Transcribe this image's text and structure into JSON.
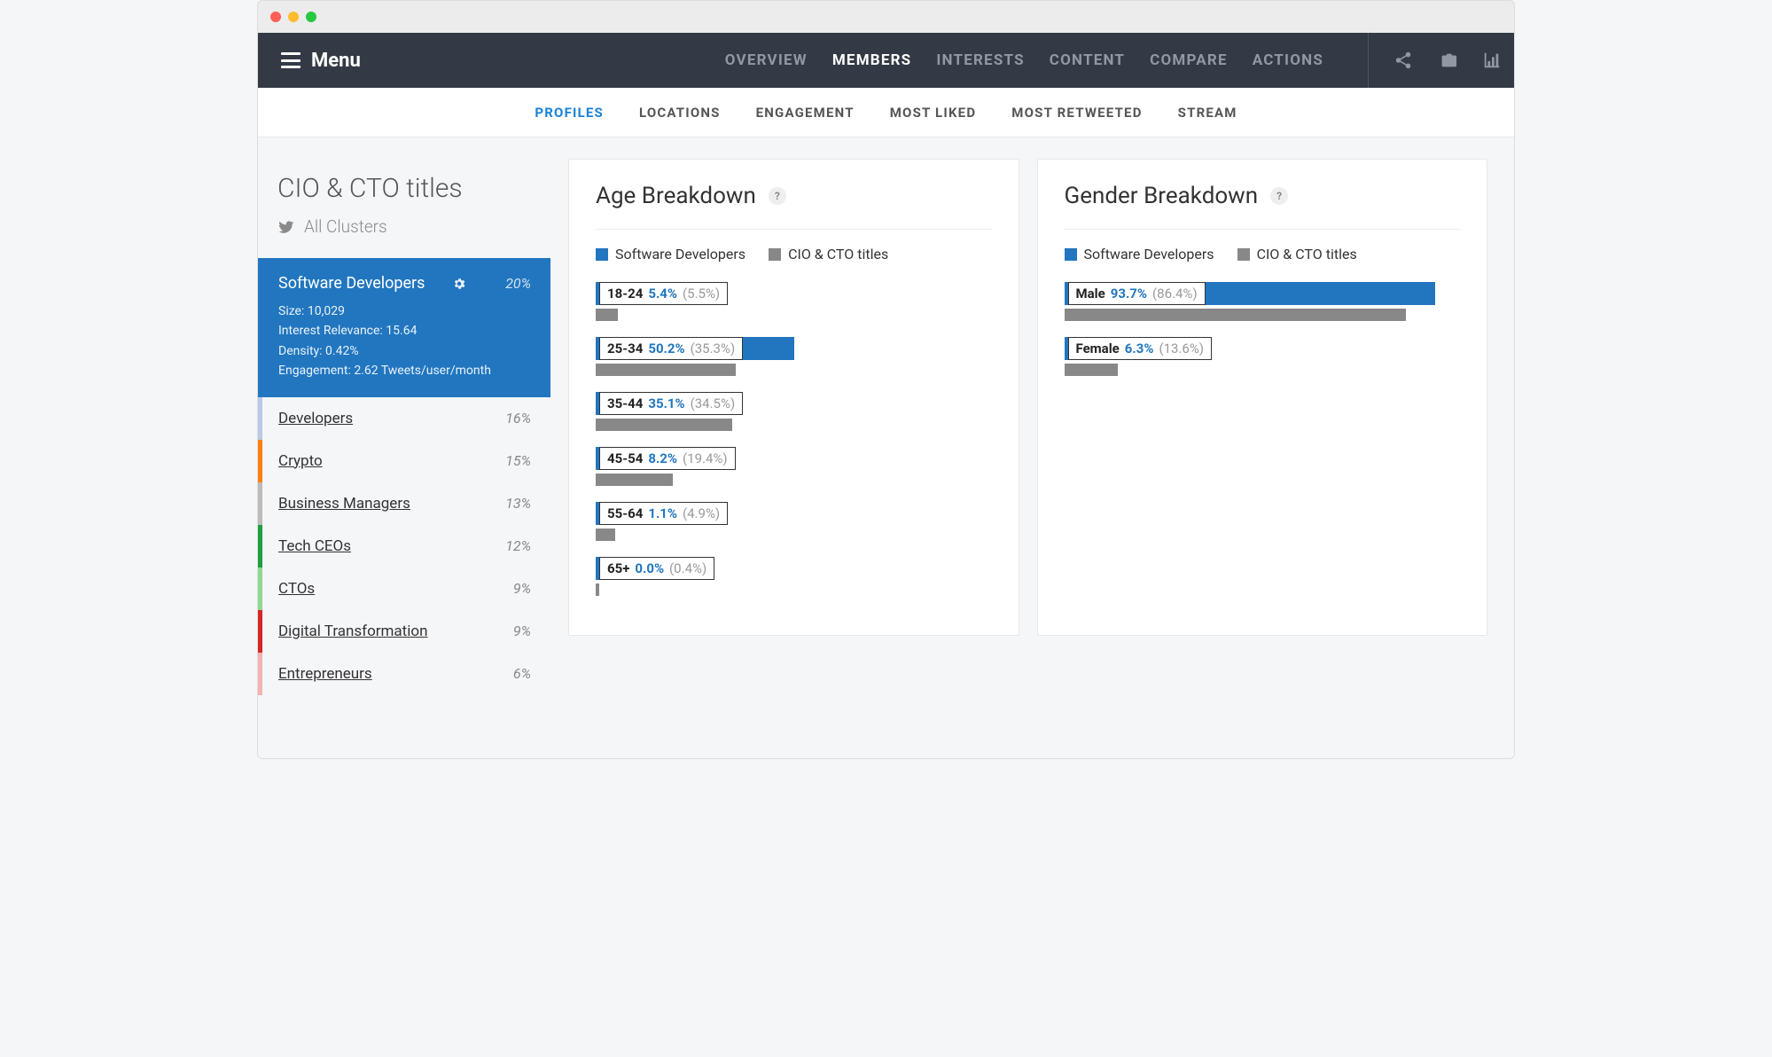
{
  "menu_label": "Menu",
  "top_tabs": [
    "OVERVIEW",
    "MEMBERS",
    "INTERESTS",
    "CONTENT",
    "COMPARE",
    "ACTIONS"
  ],
  "top_tab_active": 1,
  "sub_tabs": [
    "PROFILES",
    "LOCATIONS",
    "ENGAGEMENT",
    "MOST LIKED",
    "MOST RETWEETED",
    "STREAM"
  ],
  "sub_tab_active": 0,
  "sidebar": {
    "title": "CIO & CTO titles",
    "all_clusters": "All Clusters",
    "active": {
      "name": "Software Developers",
      "pct": "20%",
      "size_label": "Size: 10,029",
      "relevance_label": "Interest Relevance: 15.64",
      "density_label": "Density: 0.42%",
      "engagement_label": "Engagement: 2.62 Tweets/user/month"
    },
    "clusters": [
      {
        "name": "Developers",
        "pct": "16%",
        "color": "blue"
      },
      {
        "name": "Crypto",
        "pct": "15%",
        "color": "orange"
      },
      {
        "name": "Business Managers",
        "pct": "13%",
        "color": "grey"
      },
      {
        "name": "Tech CEOs",
        "pct": "12%",
        "color": "green"
      },
      {
        "name": "CTOs",
        "pct": "9%",
        "color": "lightgreen"
      },
      {
        "name": "Digital Transformation",
        "pct": "9%",
        "color": "red"
      },
      {
        "name": "Entrepreneurs",
        "pct": "6%",
        "color": "pink"
      }
    ]
  },
  "age_card": {
    "title": "Age Breakdown",
    "legend": {
      "a": "Software Developers",
      "b": "CIO & CTO titles"
    }
  },
  "gender_card": {
    "title": "Gender Breakdown",
    "legend": {
      "a": "Software Developers",
      "b": "CIO & CTO titles"
    }
  },
  "chart_data": [
    {
      "type": "bar",
      "title": "Age Breakdown",
      "orientation": "horizontal",
      "categories": [
        "18-24",
        "25-34",
        "35-44",
        "45-54",
        "55-64",
        "65+"
      ],
      "series": [
        {
          "name": "Software Developers",
          "color": "#2176bf",
          "values": [
            5.4,
            50.2,
            35.1,
            8.2,
            1.1,
            0.0
          ]
        },
        {
          "name": "CIO & CTO titles",
          "color": "#888888",
          "values": [
            5.5,
            35.3,
            34.5,
            19.4,
            4.9,
            0.4
          ]
        }
      ],
      "xlabel": "%",
      "xlim": [
        0,
        100
      ]
    },
    {
      "type": "bar",
      "title": "Gender Breakdown",
      "orientation": "horizontal",
      "categories": [
        "Male",
        "Female"
      ],
      "series": [
        {
          "name": "Software Developers",
          "color": "#2176bf",
          "values": [
            93.7,
            6.3
          ]
        },
        {
          "name": "CIO & CTO titles",
          "color": "#888888",
          "values": [
            86.4,
            13.6
          ]
        }
      ],
      "xlabel": "%",
      "xlim": [
        0,
        100
      ]
    }
  ]
}
